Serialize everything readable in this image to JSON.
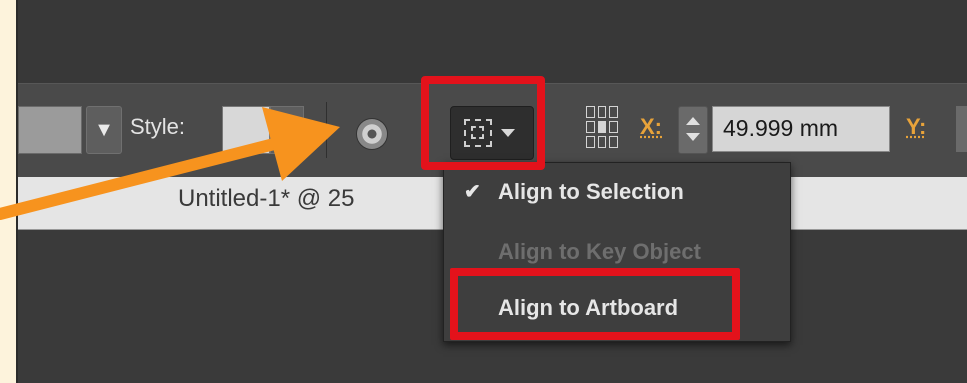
{
  "toolbar": {
    "style_label": "Style:",
    "x_label": "X:",
    "x_value": "49.999 mm",
    "y_label": "Y:"
  },
  "document": {
    "tab_title": "Untitled-1* @ 25"
  },
  "align_menu": {
    "items": [
      {
        "label": "Align to Selection",
        "checked": true,
        "enabled": true
      },
      {
        "label": "Align to Key Object",
        "checked": false,
        "enabled": false
      },
      {
        "label": "Align to Artboard",
        "checked": false,
        "enabled": true
      }
    ],
    "check_glyph": "✔"
  },
  "annotations": {
    "highlight_color": "#e3121b",
    "arrow_color": "#f7931e"
  },
  "colors": {
    "panel_bg": "#4a4a4a",
    "field_bg": "#d6d6d6",
    "axis_label": "#e8a33a",
    "page_bg": "#fdf3dc"
  }
}
